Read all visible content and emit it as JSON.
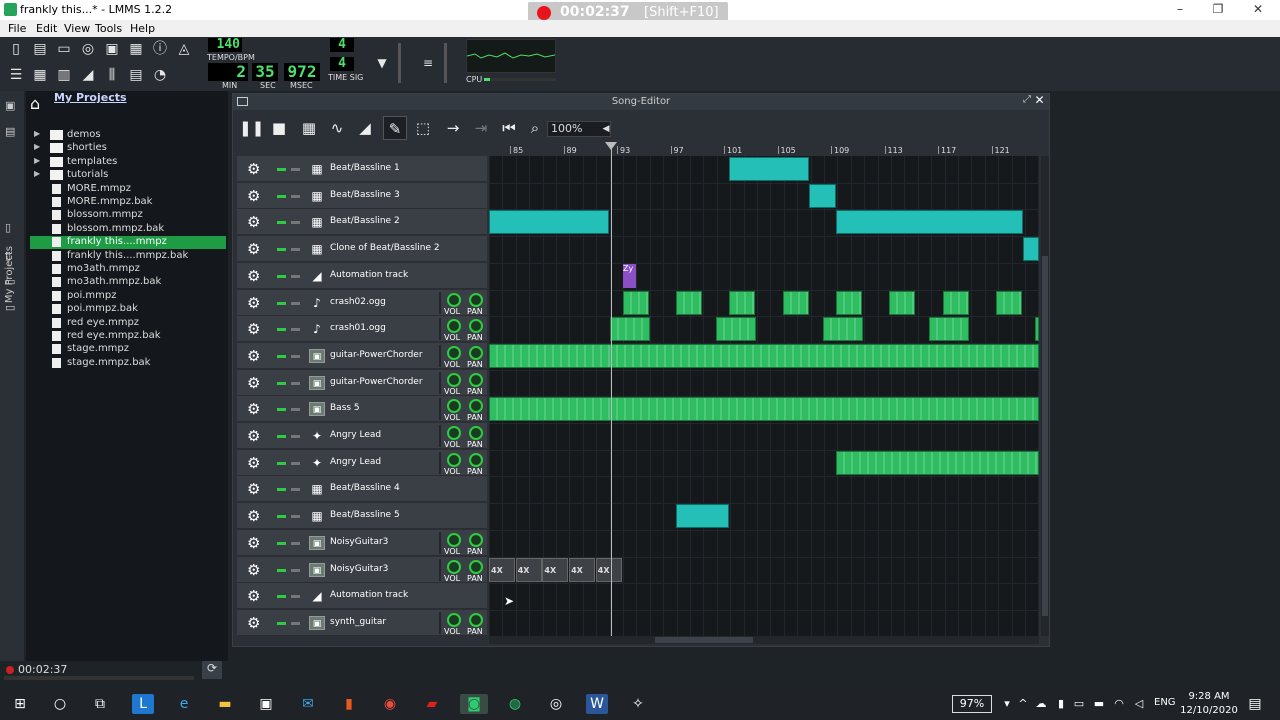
{
  "window": {
    "title": "frankly this...* - LMMS 1.2.2",
    "minimize": "–",
    "maximize": "❐",
    "close": "✕"
  },
  "recording": {
    "time": "00:02:37",
    "shortcut": "[Shift+F10]"
  },
  "menu": [
    "File",
    "Edit",
    "View",
    "Tools",
    "Help"
  ],
  "transport": {
    "tempo": "140",
    "tempo_label": "TEMPO/BPM",
    "min": "2",
    "sec": "35",
    "msec": "972",
    "min_label": "MIN",
    "sec_label": "SEC",
    "msec_label": "MSEC",
    "timesig_num": "4",
    "timesig_den": "4",
    "timesig_label": "TIME SIG",
    "cpu_label": "CPU"
  },
  "sidebar": {
    "title": "My Projects",
    "vtab_label": "My Projects",
    "items": [
      {
        "label": "demos",
        "type": "folder"
      },
      {
        "label": "shorties",
        "type": "folder"
      },
      {
        "label": "templates",
        "type": "folder"
      },
      {
        "label": "tutorials",
        "type": "folder"
      },
      {
        "label": "MORE.mmpz",
        "type": "file"
      },
      {
        "label": "MORE.mmpz.bak",
        "type": "file"
      },
      {
        "label": "blossom.mmpz",
        "type": "file"
      },
      {
        "label": "blossom.mmpz.bak",
        "type": "file"
      },
      {
        "label": "frankly this....mmpz",
        "type": "file",
        "selected": true
      },
      {
        "label": "frankly this....mmpz.bak",
        "type": "file"
      },
      {
        "label": "mo3ath.mmpz",
        "type": "file"
      },
      {
        "label": "mo3ath.mmpz.bak",
        "type": "file"
      },
      {
        "label": "poi.mmpz",
        "type": "file"
      },
      {
        "label": "poi.mmpz.bak",
        "type": "file"
      },
      {
        "label": "red eye.mmpz",
        "type": "file"
      },
      {
        "label": "red eye.mmpz.bak",
        "type": "file"
      },
      {
        "label": "stage.mmpz",
        "type": "file"
      },
      {
        "label": "stage.mmpz.bak",
        "type": "file"
      }
    ],
    "record_time": "00:02:37"
  },
  "song_editor": {
    "title": "Song-Editor",
    "zoom": "100%",
    "ticks": [
      "85",
      "89",
      "93",
      "97",
      "101",
      "105",
      "109",
      "113",
      "117",
      "121"
    ],
    "vol_label": "VOL",
    "pan_label": "PAN",
    "tracks": [
      {
        "name": "Beat/Bassline 1",
        "kind": "bb"
      },
      {
        "name": "Beat/Bassline 3",
        "kind": "bb"
      },
      {
        "name": "Beat/Bassline 2",
        "kind": "bb"
      },
      {
        "name": "Clone of Beat/Bassline 2",
        "kind": "bb"
      },
      {
        "name": "Automation track",
        "kind": "auto"
      },
      {
        "name": "crash02.ogg",
        "kind": "sample"
      },
      {
        "name": "crash01.ogg",
        "kind": "sample"
      },
      {
        "name": "guitar-PowerChorder",
        "kind": "inst"
      },
      {
        "name": "guitar-PowerChorder",
        "kind": "inst"
      },
      {
        "name": "Bass 5",
        "kind": "inst"
      },
      {
        "name": "Angry Lead",
        "kind": "lead"
      },
      {
        "name": "Angry Lead",
        "kind": "lead"
      },
      {
        "name": "Beat/Bassline 4",
        "kind": "bb"
      },
      {
        "name": "Beat/Bassline 5",
        "kind": "bb"
      },
      {
        "name": "NoisyGuitar3",
        "kind": "inst"
      },
      {
        "name": "NoisyGuitar3",
        "kind": "inst"
      },
      {
        "name": "Automation track",
        "kind": "auto"
      },
      {
        "name": "synth_guitar",
        "kind": "inst"
      }
    ],
    "auto_clip_label": "Zy",
    "noisy_clip_label": "4X"
  },
  "taskbar": {
    "battery": "97%",
    "lang": "ENG",
    "time": "9:28 AM",
    "date": "12/10/2020"
  },
  "colors": {
    "bb_clip": "#24c0b8",
    "pattern_clip": "#2ebd60",
    "selected_file": "#1e9b45",
    "record": "#e8141d"
  }
}
